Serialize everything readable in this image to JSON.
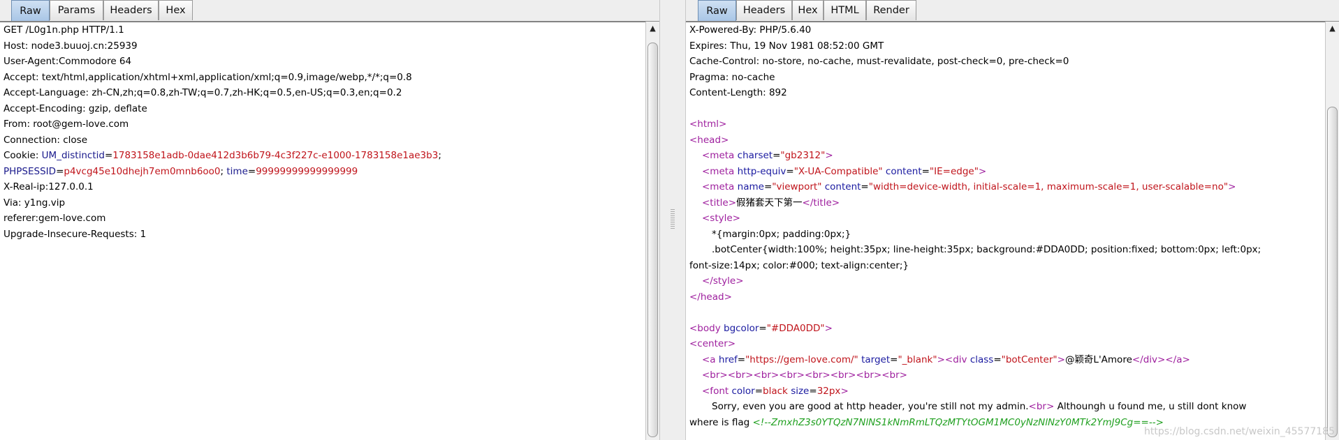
{
  "request_pane": {
    "tabs": [
      {
        "label": "Raw",
        "active": true
      },
      {
        "label": "Params",
        "active": false
      },
      {
        "label": "Headers",
        "active": false
      },
      {
        "label": "Hex",
        "active": false
      }
    ],
    "lines": {
      "request_line": "GET /L0g1n.php HTTP/1.1",
      "host": "Host: node3.buuoj.cn:25939",
      "user_agent": "User-Agent:Commodore 64",
      "accept": "Accept: text/html,application/xhtml+xml,application/xml;q=0.9,image/webp,*/*;q=0.8",
      "accept_language": "Accept-Language: zh-CN,zh;q=0.8,zh-TW;q=0.7,zh-HK;q=0.5,en-US;q=0.3,en;q=0.2",
      "accept_encoding": "Accept-Encoding: gzip, deflate",
      "from": "From: root@gem-love.com",
      "connection": "Connection: close",
      "cookie_label": "Cookie: ",
      "cookie1_name": "UM_distinctid",
      "cookie1_value": "1783158e1adb-0dae412d3b6b79-4c3f227c-e1000-1783158e1ae3b3",
      "cookie_sep": ";",
      "cookie2_name": "PHPSESSID",
      "cookie2_value": "p4vcg45e10dhejh7em0mnb6oo0",
      "cookie_sep2": "; ",
      "cookie3_name": "time",
      "cookie3_value": "99999999999999999",
      "eq": "=",
      "x_real_ip": "X-Real-ip:127.0.0.1",
      "via": "Via: y1ng.vip",
      "referer": "referer:gem-love.com",
      "upgrade": "Upgrade-Insecure-Requests: 1"
    }
  },
  "response_pane": {
    "tabs": [
      {
        "label": "Raw",
        "active": true
      },
      {
        "label": "Headers",
        "active": false
      },
      {
        "label": "Hex",
        "active": false
      },
      {
        "label": "HTML",
        "active": false
      },
      {
        "label": "Render",
        "active": false
      }
    ],
    "headers": [
      "X-Powered-By: PHP/5.6.40",
      "Expires: Thu, 19 Nov 1981 08:52:00 GMT",
      "Cache-Control: no-store, no-cache, must-revalidate, post-check=0, pre-check=0",
      "Pragma: no-cache",
      "Content-Length: 892"
    ],
    "html": {
      "html_open": "<html>",
      "head_open": "<head>",
      "meta1_tag": "<meta",
      "meta1_attr": "charset",
      "meta1_val": "\"gb2312\"",
      "meta2_attr1": "http-equiv",
      "meta2_val1": "\"X-UA-Compatible\"",
      "meta2_attr2": "content",
      "meta2_val2": "\"IE=edge\"",
      "meta3_attr1": "name",
      "meta3_val1": "\"viewport\"",
      "meta3_attr2": "content",
      "meta3_val2": "\"width=device-width, initial-scale=1, maximum-scale=1, user-scalable=no\"",
      "tag_close": ">",
      "title_open": "<title>",
      "title_text": "假猪套天下第一",
      "title_close": "</title>",
      "style_open": "<style>",
      "css1": "*{margin:0px; padding:0px;}",
      "css2": ".botCenter{width:100%; height:35px; line-height:35px; background:#DDA0DD; position:fixed; bottom:0px; left:0px;",
      "css3": "font-size:14px; color:#000; text-align:center;}",
      "style_close": "</style>",
      "head_close": "</head>",
      "body_tag": "<body",
      "body_attr": "bgcolor",
      "body_val": "\"#DDA0DD\"",
      "center_open": "<center>",
      "a_tag": "<a",
      "a_attr1": "href",
      "a_val1": "\"https://gem-love.com/\"",
      "a_attr2": "target",
      "a_val2": "\"_blank\"",
      "div_tag": "<div",
      "div_attr": "class",
      "div_val": "\"botCenter\"",
      "div_text": "@颖奇L'Amore",
      "div_close": "</div>",
      "a_close": "</a>",
      "brs": "<br><br><br><br><br><br><br><br>",
      "font_tag": "<font",
      "font_attr1": "color",
      "font_val1": "black",
      "font_attr2": "size",
      "font_val2": "32px",
      "sorry_text": "Sorry, even you are good at http header, you're still not my admin.",
      "br": "<br>",
      "sorry_text2": " Althoungh u found me, u still dont know",
      "where_text": "where is flag ",
      "flag_comment": "<!--ZmxhZ3s0YTQzN7NlNS1kNmRmLTQzMTYtOGM1MC0yNzNlNzY0MTk2YmJ9Cg==-->"
    }
  },
  "watermark": "https://blog.csdn.net/weixin_45577185"
}
